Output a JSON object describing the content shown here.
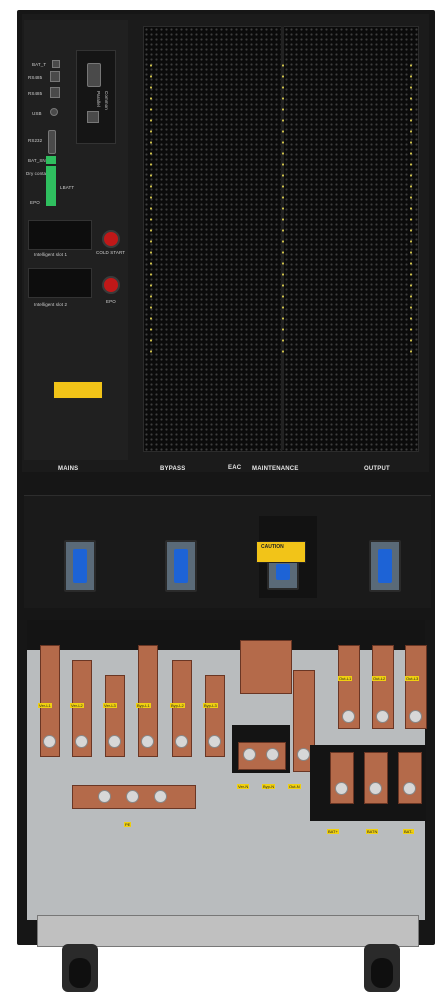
{
  "control_panel": {
    "ports": [
      "BAT_T",
      "RS485",
      "RS485",
      "USB",
      "RS232"
    ],
    "bat_sn": "BAT_SN",
    "dry_contacts": "Dry contacts",
    "lbatt": "LBATT",
    "epo_port": "EPO",
    "slot1": "Intelligent slot 1",
    "slot2": "Intelligent slot 2",
    "cold_start": "COLD START",
    "epo_button": "EPO",
    "parallel": "Parallel",
    "com": "Common"
  },
  "switch_labels": {
    "mains": "MAINS",
    "bypass": "BYPASS",
    "eac": "EAC",
    "maintenance": "MAINTENANCE",
    "output": "OUTPUT"
  },
  "caution": "CAUTION",
  "terminals": {
    "input": [
      "Ver-L1",
      "Ver-L2",
      "Ver-L3",
      "Byp-L1",
      "Byp-L2",
      "Byp-L3"
    ],
    "neutral": [
      "Ver-N",
      "Byp-N",
      "Out-N"
    ],
    "output": [
      "Out-L1",
      "Out-L2",
      "Out-L3"
    ],
    "pe": "PE",
    "battery": [
      "BAT+",
      "BATN",
      "BAT-"
    ]
  },
  "colors": {
    "cabinet": "#161616",
    "switch": "#1d63d6",
    "copper": "#b46a4a",
    "warning": "#f2c418",
    "emergency": "#c01818"
  }
}
